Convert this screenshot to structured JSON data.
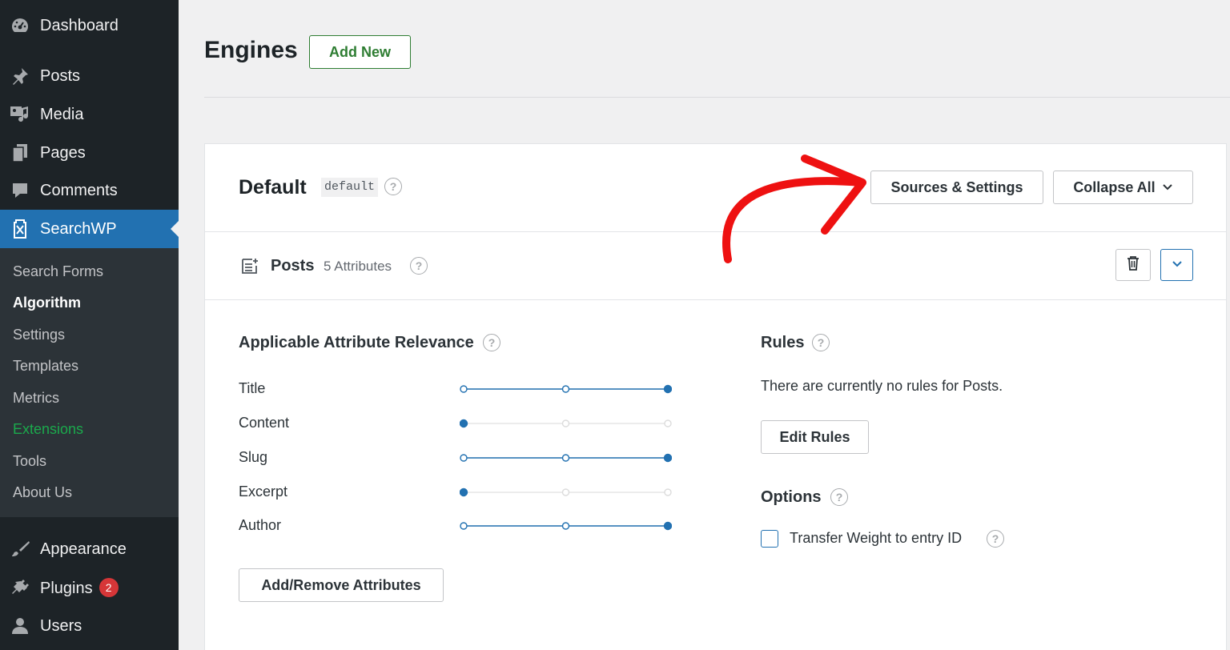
{
  "sidebar": {
    "top_items": [
      {
        "label": "Dashboard",
        "icon": "dashboard-icon"
      },
      {
        "label": "Posts",
        "icon": "pin-icon"
      },
      {
        "label": "Media",
        "icon": "media-icon"
      },
      {
        "label": "Pages",
        "icon": "pages-icon"
      },
      {
        "label": "Comments",
        "icon": "comment-icon"
      },
      {
        "label": "SearchWP",
        "icon": "searchwp-icon"
      }
    ],
    "submenu": [
      "Search Forms",
      "Algorithm",
      "Settings",
      "Templates",
      "Metrics",
      "Extensions",
      "Tools",
      "About Us"
    ],
    "bottom_items": [
      {
        "label": "Appearance",
        "icon": "brush-icon"
      },
      {
        "label": "Plugins",
        "icon": "plug-icon",
        "badge": "2"
      },
      {
        "label": "Users",
        "icon": "user-icon"
      }
    ]
  },
  "header": {
    "title": "Engines",
    "add_new": "Add New"
  },
  "engine": {
    "name": "Default",
    "slug": "default",
    "sources_settings": "Sources & Settings",
    "collapse_all": "Collapse All",
    "source": {
      "title": "Posts",
      "count": "5 Attributes",
      "relevance_title": "Applicable Attribute Relevance",
      "attributes": [
        {
          "label": "Title",
          "level": 3
        },
        {
          "label": "Content",
          "level": 1
        },
        {
          "label": "Slug",
          "level": 3
        },
        {
          "label": "Excerpt",
          "level": 1
        },
        {
          "label": "Author",
          "level": 3
        }
      ],
      "add_remove": "Add/Remove Attributes",
      "rules_title": "Rules",
      "rules_text": "There are currently no rules for Posts.",
      "edit_rules": "Edit Rules",
      "options_title": "Options",
      "transfer_label": "Transfer Weight to entry ID"
    }
  },
  "colors": {
    "accent": "#2271b1",
    "arrow": "#ee1111",
    "green": "#2e7d32"
  }
}
